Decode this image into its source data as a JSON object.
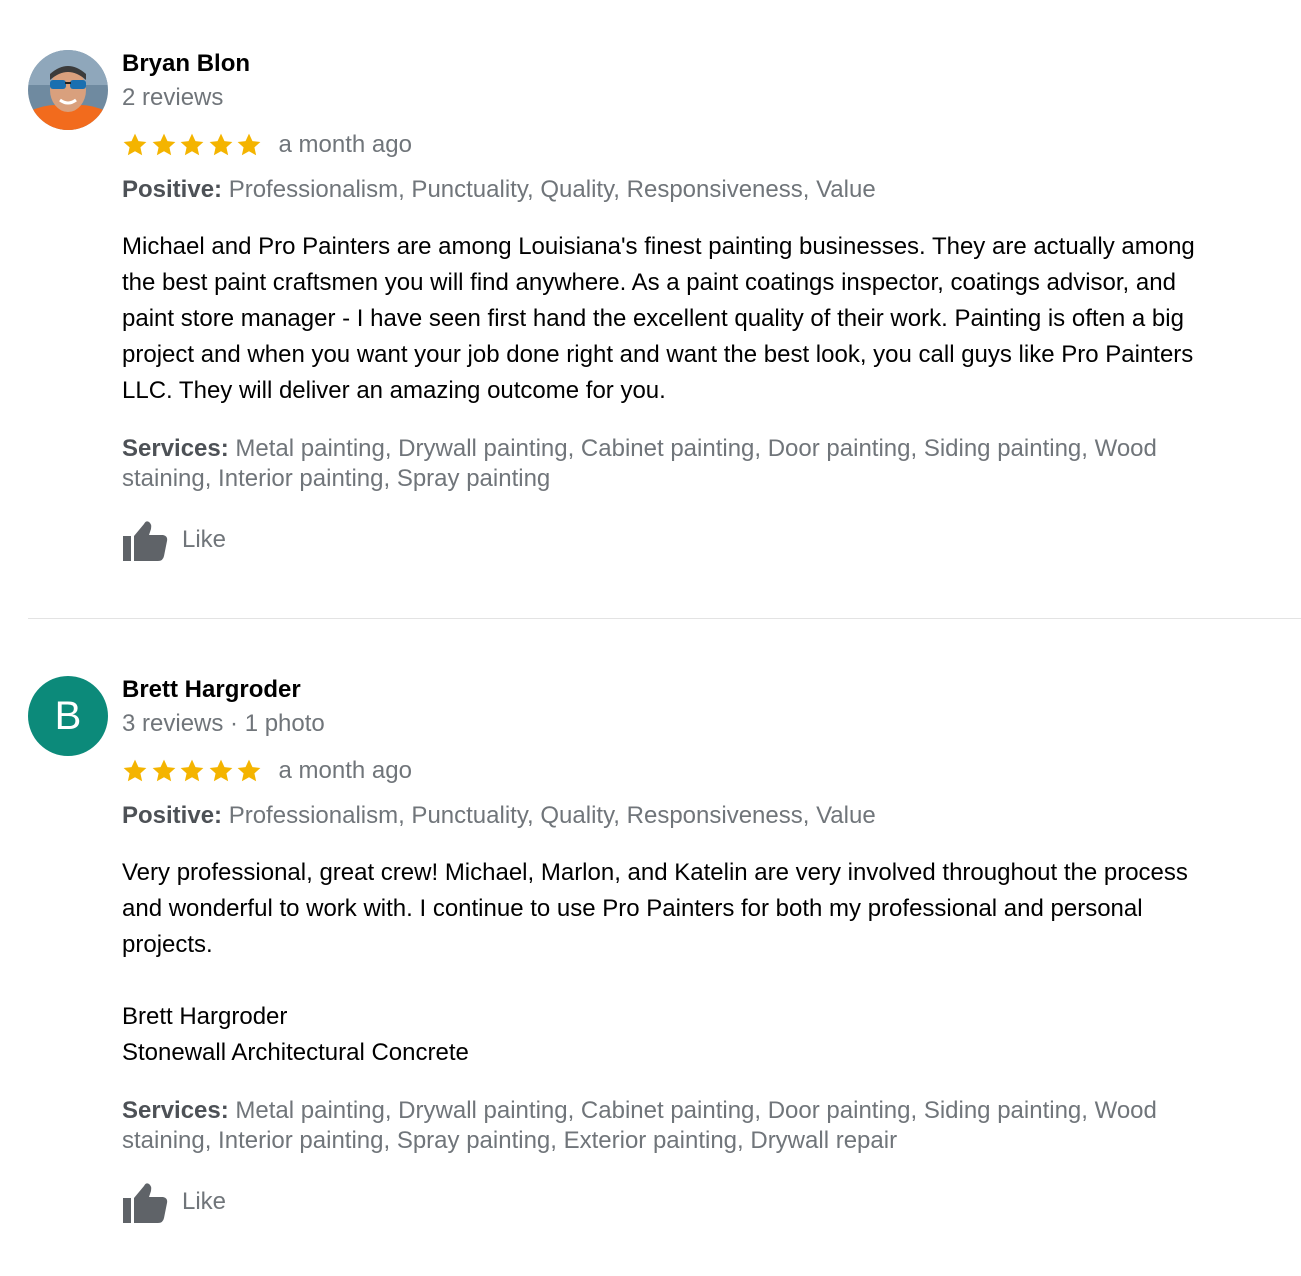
{
  "reviews": [
    {
      "avatar": {
        "type": "photo",
        "description": "man with sunglasses and orange shirt"
      },
      "name": "Bryan Blon",
      "meta": "2 reviews",
      "rating": 5,
      "date": "a month ago",
      "positive_label": "Positive:",
      "positive_text": "Professionalism, Punctuality, Quality, Responsiveness, Value",
      "body_lines": [
        "Michael and Pro Painters are among Louisiana's finest painting businesses. They are actually among",
        "the best paint craftsmen you will find anywhere. As a paint coatings inspector, coatings advisor, and",
        "paint store manager - I have seen first hand the excellent quality of their work. Painting is often a big",
        "project and when you want your job done right and want the best look, you call guys like Pro Painters",
        "LLC. They will deliver an amazing outcome for you."
      ],
      "services_label": "Services:",
      "services_lines": [
        "Metal painting, Drywall painting, Cabinet painting, Door painting, Siding painting, Wood",
        "staining, Interior painting, Spray painting"
      ],
      "like_label": "Like"
    },
    {
      "avatar": {
        "type": "letter",
        "letter": "B",
        "color": "#0c8a7a"
      },
      "name": "Brett Hargroder",
      "meta": "3 reviews · 1 photo",
      "rating": 5,
      "date": "a month ago",
      "positive_label": "Positive:",
      "positive_text": "Professionalism, Punctuality, Quality, Responsiveness, Value",
      "body_lines": [
        "Very professional, great crew!  Michael, Marlon, and Katelin are  very involved throughout the process",
        "and wonderful to work with.  I continue to use Pro Painters for both my professional and personal",
        "projects.",
        "",
        "Brett Hargroder",
        "Stonewall Architectural Concrete"
      ],
      "services_label": "Services:",
      "services_lines": [
        "Metal painting, Drywall painting, Cabinet painting, Door painting, Siding painting, Wood",
        "staining, Interior painting, Spray painting, Exterior painting, Drywall repair"
      ],
      "like_label": "Like"
    }
  ],
  "colors": {
    "star": "#f4b400",
    "muted_text": "#70757a",
    "divider": "#e3e3e3"
  },
  "icons": [
    "star-icon",
    "thumbs-up-icon"
  ]
}
